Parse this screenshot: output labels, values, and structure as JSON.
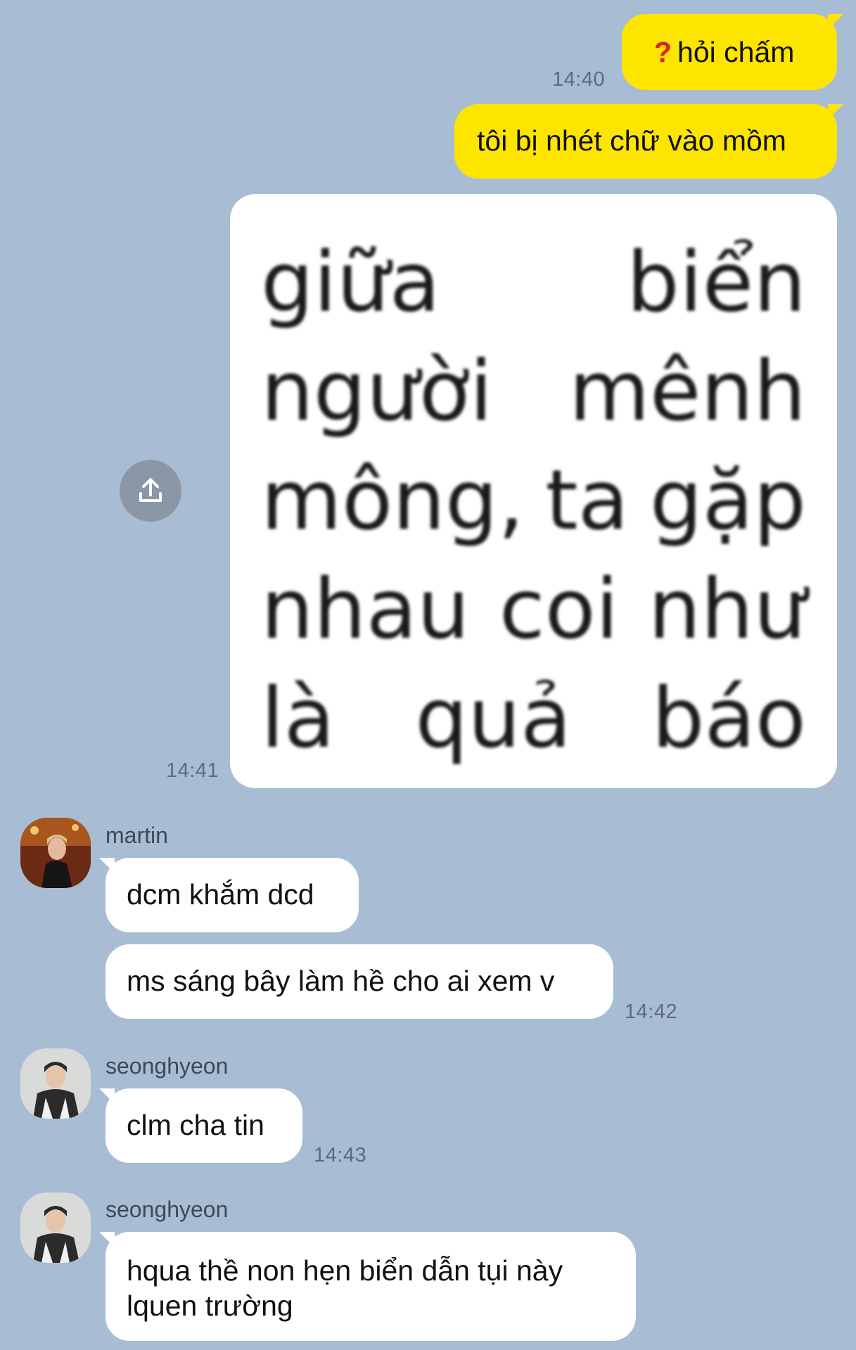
{
  "messages_out": [
    {
      "text": "hỏi chấm",
      "icon": "red-question-mark",
      "time": "14:40"
    },
    {
      "text": "tôi bị nhét chữ vào mồm"
    }
  ],
  "image_message": {
    "lines": [
      [
        "giữa",
        "biển"
      ],
      [
        "người",
        "mênh"
      ],
      [
        "mông,",
        "ta",
        "gặp"
      ],
      [
        "nhau",
        "coi",
        "như"
      ],
      [
        "là",
        "quả",
        "báo"
      ]
    ],
    "time": "14:41",
    "share_icon": "share-upload-icon"
  },
  "groups": [
    {
      "sender": "martin",
      "messages": [
        "dcm khắm dcd",
        "ms sáng bây làm hề cho ai xem v"
      ],
      "time": "14:42"
    },
    {
      "sender": "seonghyeon",
      "messages": [
        "clm cha tin"
      ],
      "time": "14:43"
    },
    {
      "sender": "seonghyeon",
      "messages": [
        "hqua thề non hẹn biển dẫn tụi này",
        "lquen trường"
      ]
    }
  ],
  "colors": {
    "background": "#a8bdd3",
    "outgoing_bubble": "#fee500",
    "incoming_bubble": "#ffffff"
  }
}
